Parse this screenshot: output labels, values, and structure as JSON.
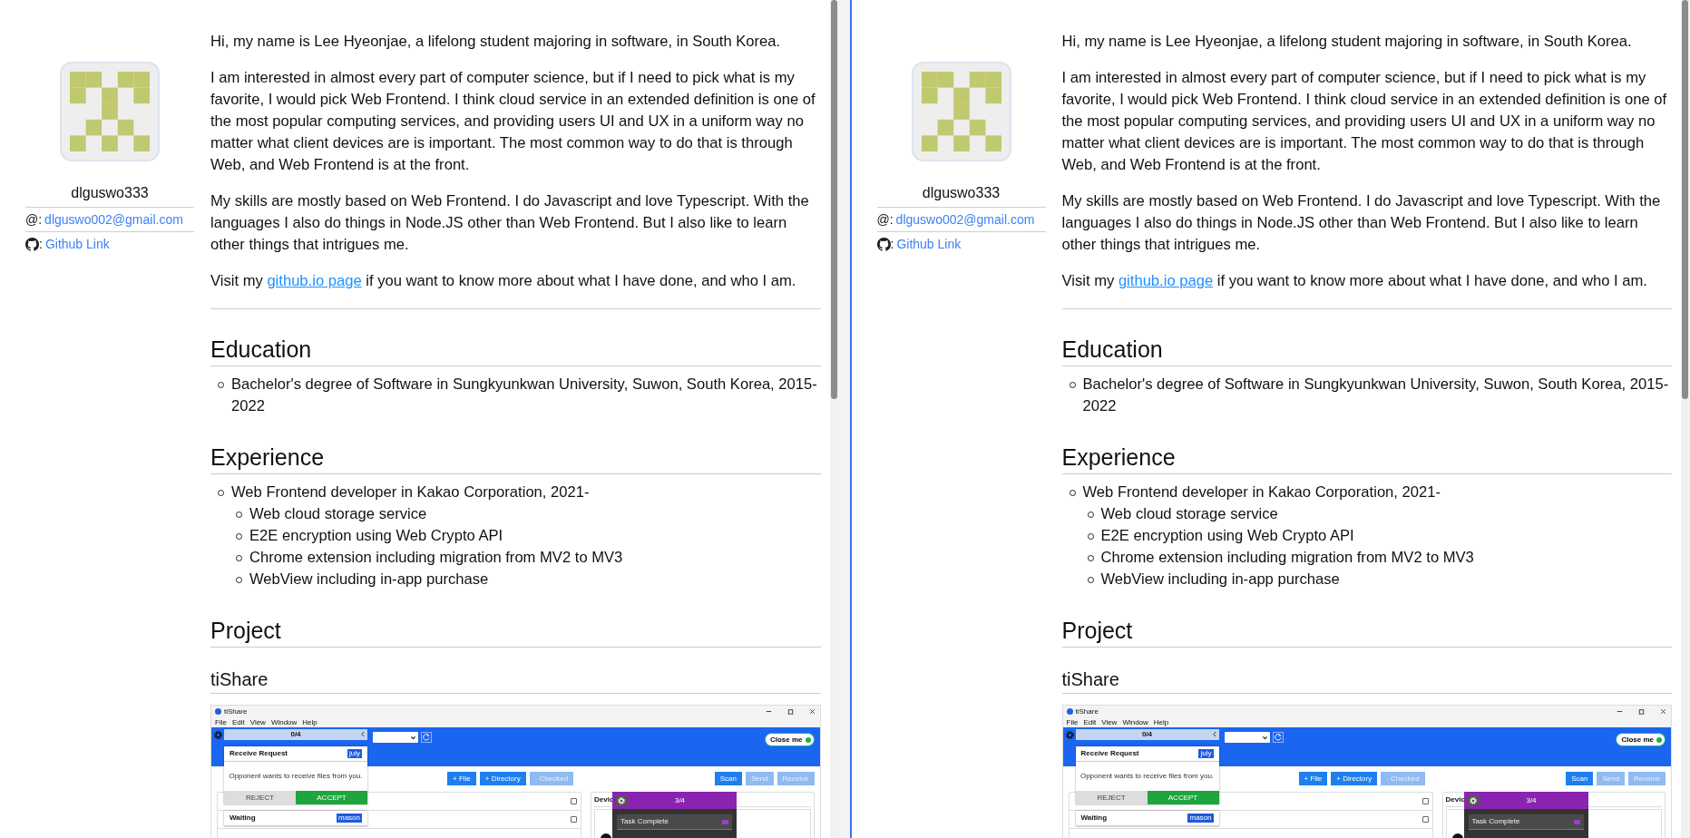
{
  "panes": [
    {
      "profile": {
        "username": "dlguswo333",
        "email_label": "@:",
        "email": "dlguswo002@gmail.com",
        "github_label": ":",
        "github_link": "Github Link"
      },
      "intro": [
        "Hi, my name is Lee Hyeonjae, a lifelong student majoring in software, in South Korea.",
        "I am interested in almost every part of computer science, but if I need to pick what is my favorite, I would pick Web Frontend. I think cloud service in an extended definition is one of the most popular computing services, and providing users UI and UX in a uniform way no matter what client devices are is important. The most common way to do that is through Web, and Web Frontend is at the front.",
        "My skills are mostly based on Web Frontend. I do Javascript and love Typescript. With the languages I also do things in Node.JS other than Web Frontend. But I also like to learn other things that intrigues me."
      ],
      "visit": {
        "before": "Visit my ",
        "link": "github.io page",
        "after": " if you want to know more about what I have done, and who I am."
      },
      "sections": [
        {
          "heading": "Education",
          "items": [
            {
              "text": "Bachelor's degree of Software in Sungkyunkwan University, Suwon, South Korea, 2015-2022"
            }
          ]
        },
        {
          "heading": "Experience",
          "items": [
            {
              "text": "Web Frontend developer in Kakao Corporation, 2021-",
              "children": [
                {
                  "text": "Web cloud storage service"
                },
                {
                  "text": "E2E encryption using Web Crypto API"
                },
                {
                  "text": "Chrome extension including migration from MV2 to MV3"
                },
                {
                  "text": "WebView including in-app purchase"
                }
              ]
            }
          ]
        },
        {
          "heading": "Project"
        }
      ],
      "project": {
        "title": "tiShare",
        "app": {
          "title": "tiShare",
          "menu": [
            "File",
            "Edit",
            "View",
            "Window",
            "Help"
          ],
          "close_button": "Close me",
          "drawer": {
            "counter": "0/4",
            "cards": [
              {
                "title": "Receive Request",
                "tag": "july",
                "message": "Opponent wants to receive files from you.",
                "actions": [
                  {
                    "label": "REJECT",
                    "kind": "reject"
                  },
                  {
                    "label": "ACCEPT",
                    "kind": "accept"
                  }
                ]
              },
              {
                "title": "Waiting",
                "tag": "mason"
              }
            ]
          },
          "toolbar_left": [
            {
              "label": "+ File",
              "disabled": false
            },
            {
              "label": "+ Directory",
              "disabled": false
            },
            {
              "label": "- Checked",
              "disabled": true
            }
          ],
          "toolbar_right": [
            {
              "label": "Scan",
              "disabled": false
            },
            {
              "label": "Send",
              "disabled": true
            },
            {
              "label": "Receive",
              "disabled": true
            }
          ],
          "file_rows": [
            {
              "checked": false
            },
            {
              "checked": false
            }
          ],
          "devices_heading": "Devic",
          "popup": {
            "counter": "3/4",
            "task": "Task Complete"
          }
        }
      }
    },
    {
      "profile": {
        "username": "dlguswo333",
        "email_label": "@:",
        "email": "dlguswo002@gmail.com",
        "github_label": ":",
        "github_link": "Github Link"
      },
      "intro": [
        "Hi, my name is Lee Hyeonjae, a lifelong student majoring in software, in South Korea.",
        "I am interested in almost every part of computer science, but if I need to pick what is my favorite, I would pick Web Frontend. I think cloud service in an extended definition is one of the most popular computing services, and providing users UI and UX in a uniform way no matter what client devices are is important. The most common way to do that is through Web, and Web Frontend is at the front.",
        "My skills are mostly based on Web Frontend. I do Javascript and love Typescript. With the languages I also do things in Node.JS other than Web Frontend. But I also like to learn other things that intrigues me."
      ],
      "visit": {
        "before": "Visit my ",
        "link": "github.io page",
        "after": " if you want to know more about what I have done, and who I am."
      },
      "sections": [
        {
          "heading": "Education",
          "items": [
            {
              "text": "Bachelor's degree of Software in Sungkyunkwan University, Suwon, South Korea, 2015-2022"
            }
          ]
        },
        {
          "heading": "Experience",
          "items": [
            {
              "text": "Web Frontend developer in Kakao Corporation, 2021-",
              "children": [
                {
                  "text": "Web cloud storage service"
                },
                {
                  "text": "E2E encryption using Web Crypto API"
                },
                {
                  "text": "Chrome extension including migration from MV2 to MV3"
                },
                {
                  "text": "WebView including in-app purchase"
                }
              ]
            }
          ]
        },
        {
          "heading": "Project"
        }
      ],
      "project": {
        "title": "tiShare",
        "app": {
          "title": "tiShare",
          "menu": [
            "File",
            "Edit",
            "View",
            "Window",
            "Help"
          ],
          "close_button": "Close me",
          "drawer": {
            "counter": "0/4",
            "cards": [
              {
                "title": "Receive Request",
                "tag": "july",
                "message": "Opponent wants to receive files from you.",
                "actions": [
                  {
                    "label": "REJECT",
                    "kind": "reject"
                  },
                  {
                    "label": "ACCEPT",
                    "kind": "accept"
                  }
                ]
              },
              {
                "title": "Waiting",
                "tag": "mason"
              }
            ]
          },
          "toolbar_left": [
            {
              "label": "+ File",
              "disabled": false
            },
            {
              "label": "+ Directory",
              "disabled": false
            },
            {
              "label": "- Checked",
              "disabled": true
            }
          ],
          "toolbar_right": [
            {
              "label": "Scan",
              "disabled": false
            },
            {
              "label": "Send",
              "disabled": true
            },
            {
              "label": "Receive",
              "disabled": true
            }
          ],
          "file_rows": [
            {
              "checked": false
            },
            {
              "checked": false
            }
          ],
          "devices_heading": "Devic",
          "popup": {
            "counter": "3/4",
            "task": "Task Complete"
          }
        }
      }
    }
  ]
}
